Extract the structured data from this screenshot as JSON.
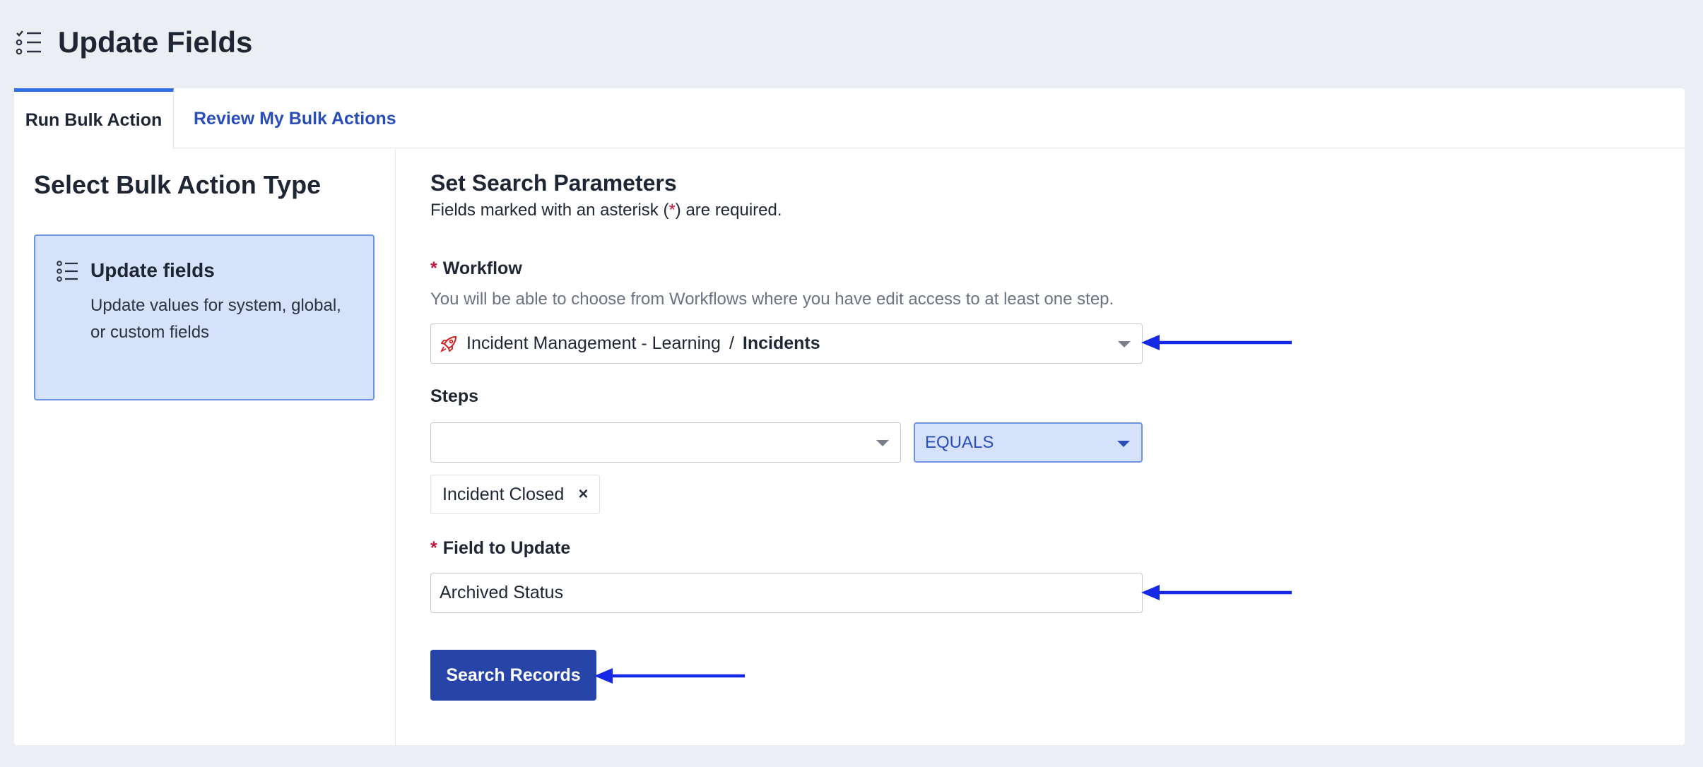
{
  "page": {
    "title": "Update Fields",
    "header_icon": "checklist-icon"
  },
  "tabs": [
    {
      "label": "Run Bulk Action",
      "active": true
    },
    {
      "label": "Review My Bulk Actions",
      "active": false
    }
  ],
  "left_panel": {
    "title": "Select Bulk Action Type",
    "selected_type": {
      "icon": "list-icon",
      "title": "Update fields",
      "description": "Update values for system, global, or custom fields"
    }
  },
  "search_params": {
    "title": "Set Search Parameters",
    "required_note_prefix": "Fields marked with an asterisk (",
    "required_note_star": "*",
    "required_note_suffix": ") are required.",
    "workflow": {
      "required_mark": "*",
      "label": "Workflow",
      "help": "You will be able to choose from Workflows where you have edit access to at least one step.",
      "icon": "rocket-icon",
      "app_name": "Incident Management - Learning",
      "separator": "/",
      "workflow_name": "Incidents"
    },
    "steps": {
      "label": "Steps",
      "step_value": "",
      "operator": "EQUALS",
      "chips": [
        {
          "label": "Incident Closed",
          "remove_symbol": "×"
        }
      ]
    },
    "field_to_update": {
      "required_mark": "*",
      "label": "Field to Update",
      "value": "Archived Status"
    },
    "search_button": "Search Records"
  },
  "colors": {
    "accent": "#2f6fe4",
    "link": "#2a4eb8",
    "primary_button": "#2744a8",
    "selected_fill": "#d6e2f9",
    "required_star": "#c0183c",
    "annotation_arrow": "#1428e6"
  }
}
